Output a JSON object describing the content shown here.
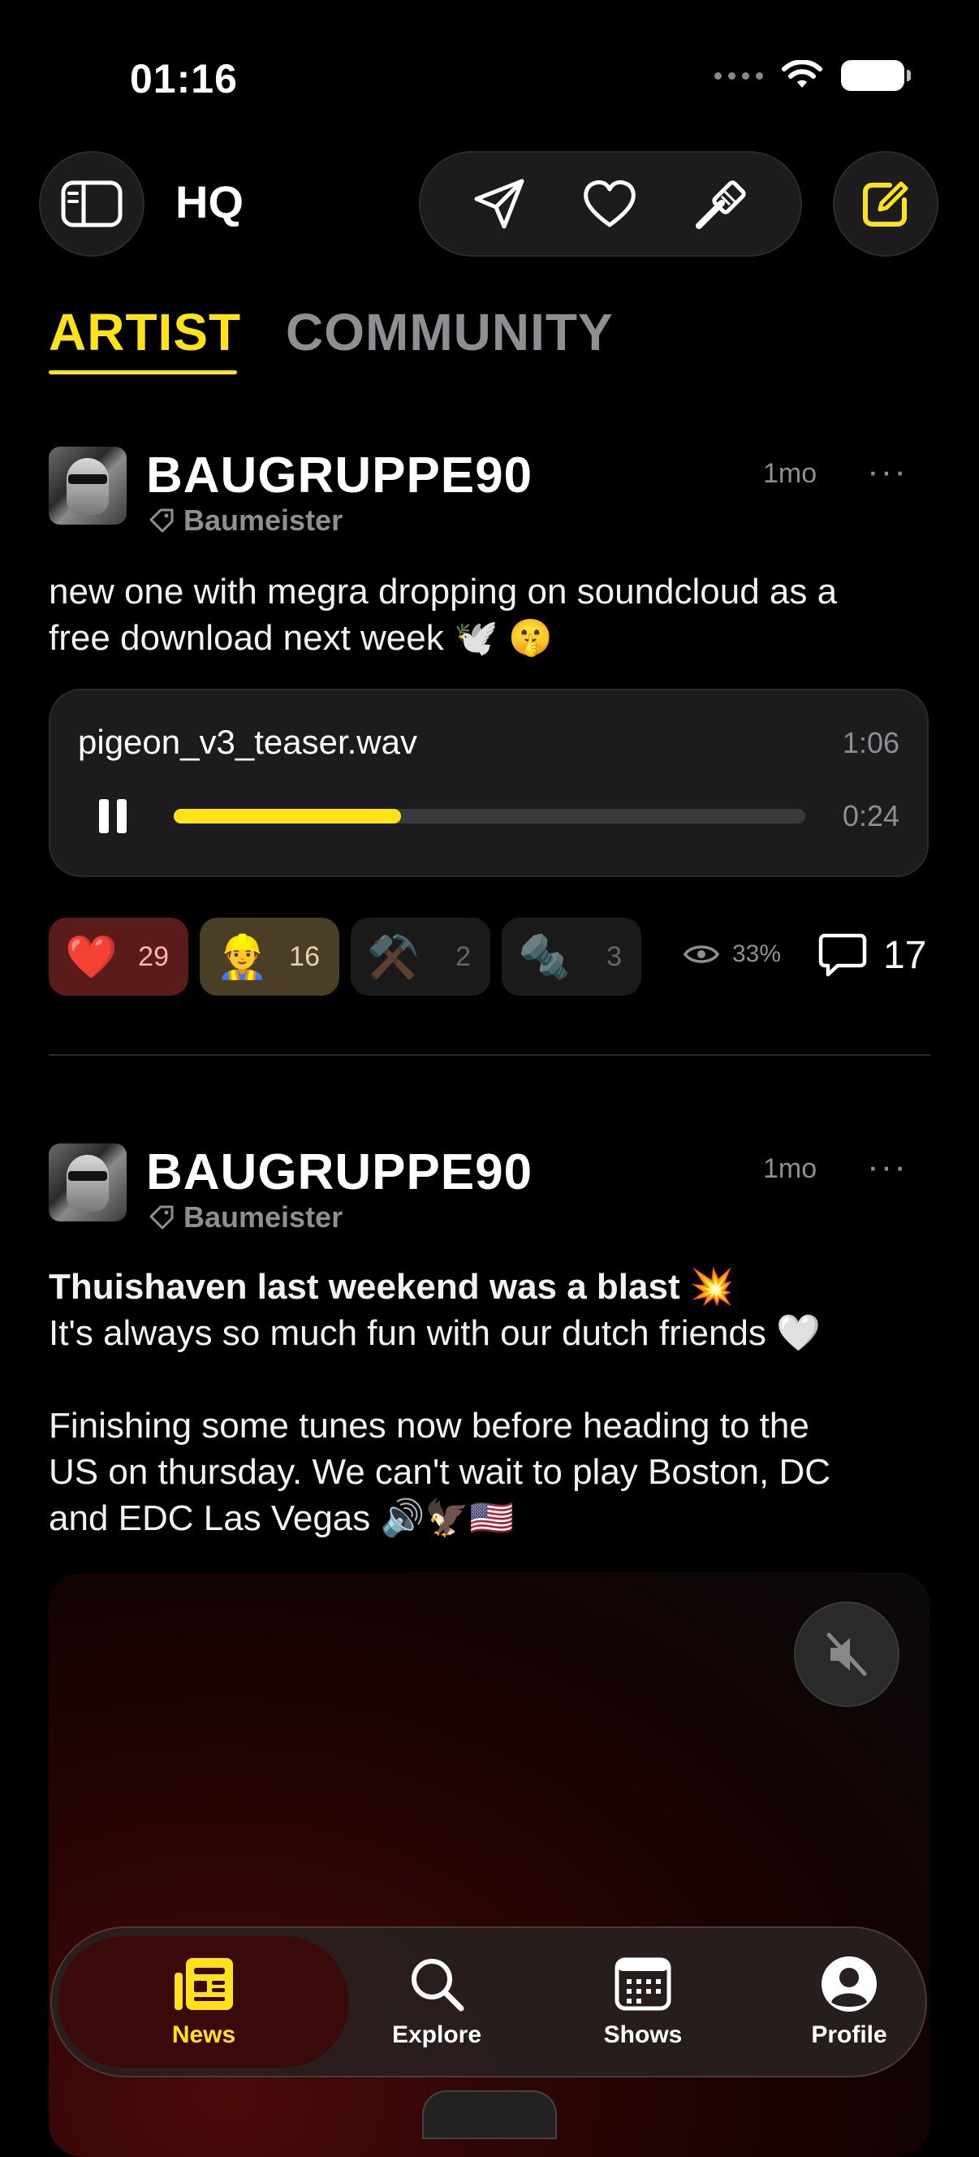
{
  "status_bar": {
    "time": "01:16"
  },
  "header": {
    "title": "HQ"
  },
  "tabs": [
    {
      "label": "ARTIST",
      "active": true
    },
    {
      "label": "COMMUNITY",
      "active": false
    }
  ],
  "posts": [
    {
      "author": "BAUGRUPPE90",
      "role": "Baumeister",
      "time_ago": "1mo",
      "text_lines": [
        "new one with megra dropping on soundcloud as a",
        "free download next week 🕊️ 🤫"
      ],
      "audio": {
        "filename": "pigeon_v3_teaser.wav",
        "duration": "1:06",
        "position": "0:24",
        "progress": 0.36
      },
      "reactions": [
        {
          "emoji": "❤️",
          "count": "29"
        },
        {
          "emoji": "👷",
          "count": "16"
        },
        {
          "emoji": "⚒️",
          "count": "2"
        },
        {
          "emoji": "🔩",
          "count": "3"
        }
      ],
      "views": "33%",
      "comments": "17"
    },
    {
      "author": "BAUGRUPPE90",
      "role": "Baumeister",
      "time_ago": "1mo",
      "text_bold": "Thuishaven last weekend was a blast 💥",
      "text_lines": [
        "It's always so much fun with our dutch friends 🤍",
        "",
        "Finishing some tunes now before heading to the",
        "US on thursday. We can't wait to play Boston, DC",
        "and EDC Las Vegas 🔊🦅🇺🇸"
      ]
    }
  ],
  "tabbar": [
    {
      "label": "News",
      "icon": "news-icon",
      "active": true
    },
    {
      "label": "Explore",
      "icon": "search-icon"
    },
    {
      "label": "Shows",
      "icon": "calendar-icon"
    },
    {
      "label": "Profile",
      "icon": "profile-icon"
    }
  ],
  "colors": {
    "accent": "#ffe21a",
    "background": "#000000",
    "muted": "#8e8e93"
  }
}
